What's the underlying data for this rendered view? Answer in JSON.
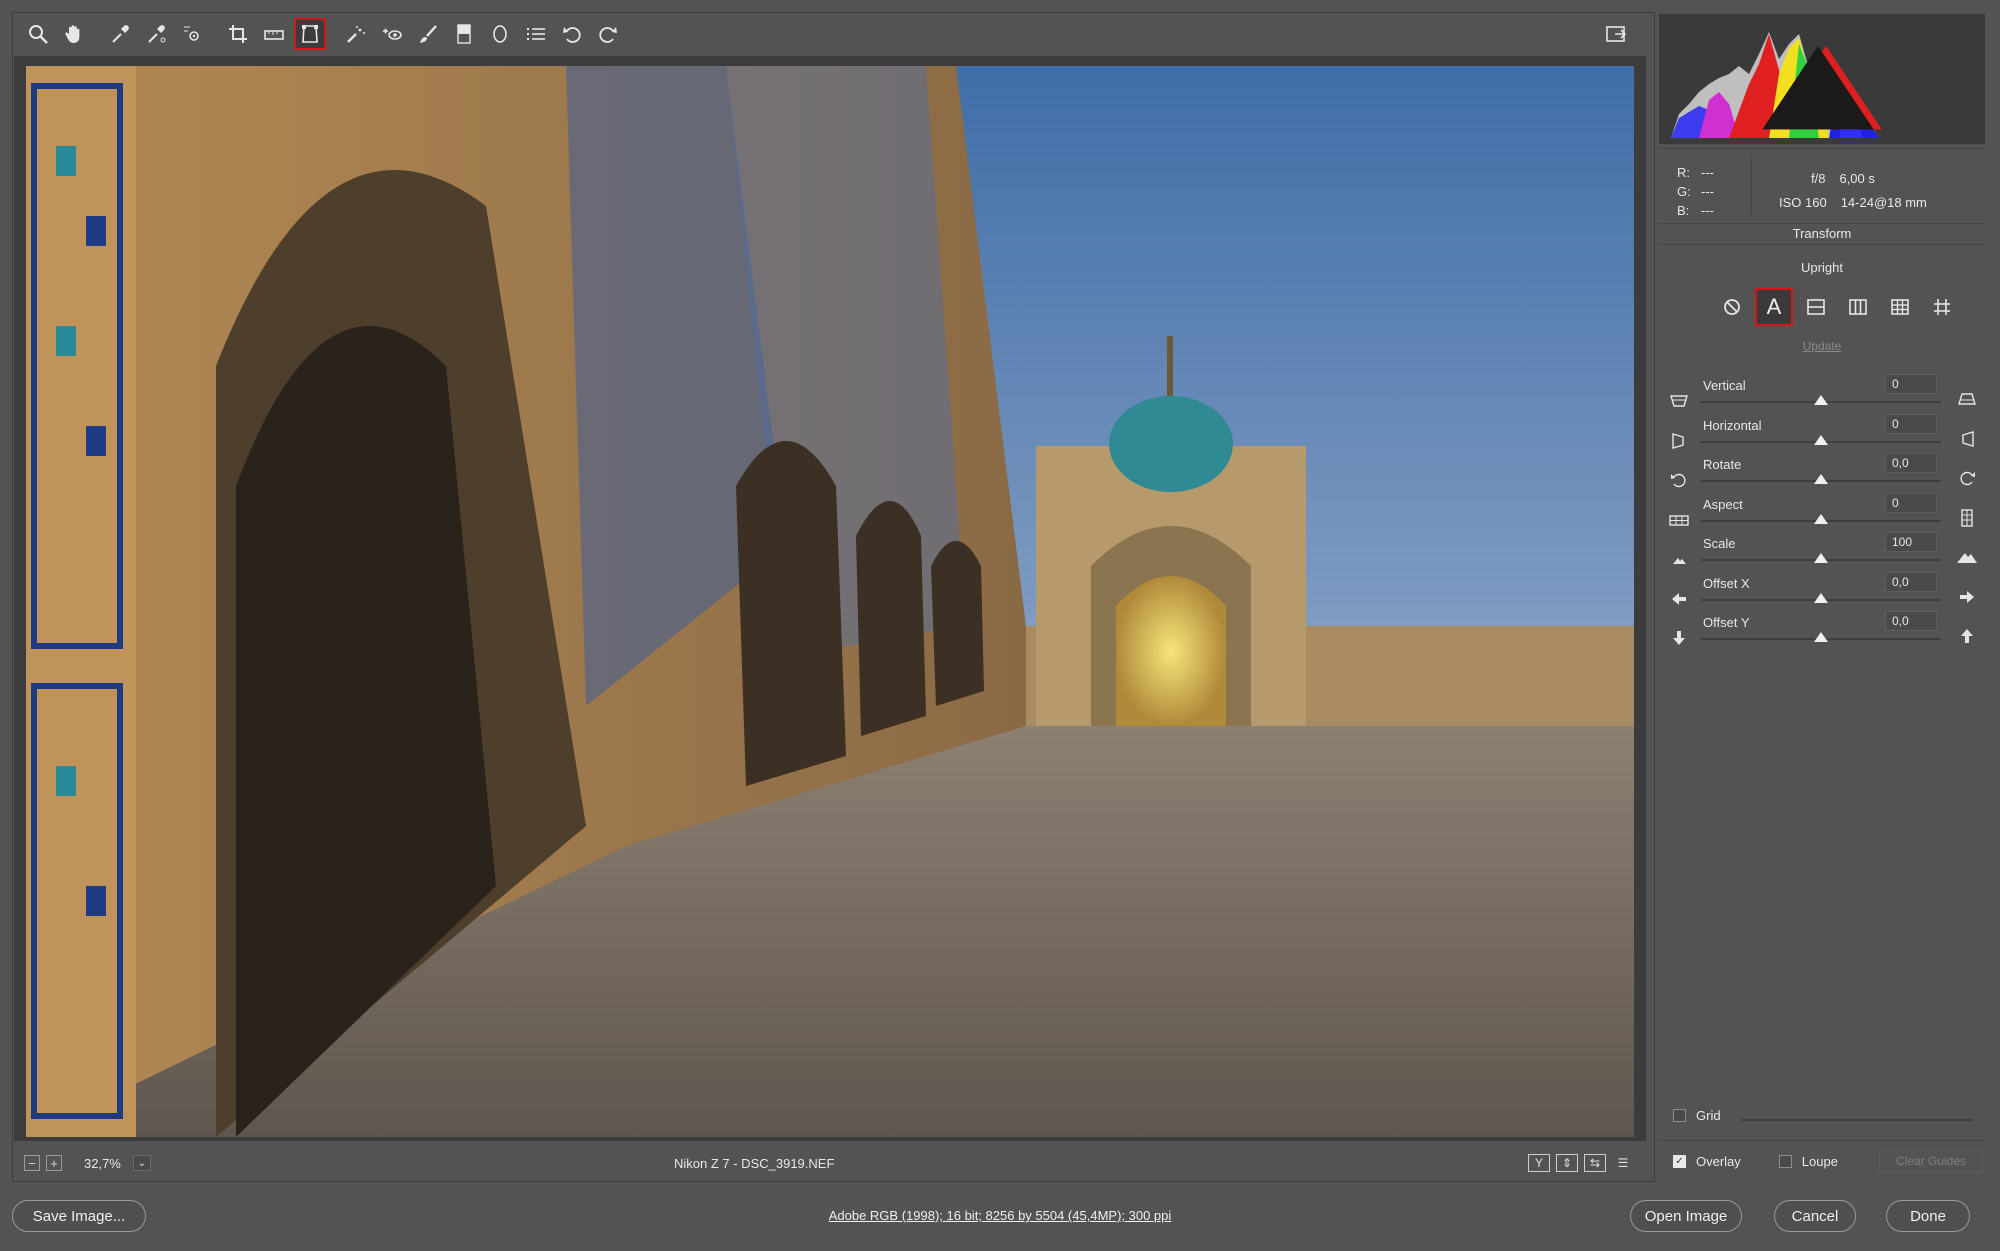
{
  "toolbar": {
    "tools": [
      {
        "name": "zoom-tool-icon"
      },
      {
        "name": "hand-tool-icon"
      },
      {
        "name": "white-balance-tool-icon"
      },
      {
        "name": "color-sampler-tool-icon"
      },
      {
        "name": "targeted-adjustment-tool-icon"
      },
      {
        "name": "crop-tool-icon"
      },
      {
        "name": "straighten-tool-icon"
      },
      {
        "name": "transform-tool-icon",
        "active": true
      },
      {
        "name": "spot-removal-tool-icon"
      },
      {
        "name": "red-eye-removal-tool-icon"
      },
      {
        "name": "adjustment-brush-icon"
      },
      {
        "name": "graduated-filter-icon"
      },
      {
        "name": "radial-filter-icon"
      },
      {
        "name": "preferences-icon"
      },
      {
        "name": "rotate-ccw-icon"
      },
      {
        "name": "rotate-cw-icon"
      }
    ],
    "fullscreen_icon": "toggle-fullscreen-icon"
  },
  "status": {
    "zoom_minus": "−",
    "zoom_plus": "+",
    "zoom_value": "32,7%",
    "zoom_dropdown": "⌄",
    "file_name": "Nikon Z 7  -  DSC_3919.NEF",
    "view_buttons": [
      "Y",
      "⇕",
      "⇆",
      "☰"
    ]
  },
  "panel": {
    "rgb": {
      "r_key": "R:",
      "r_val": "---",
      "g_key": "G:",
      "g_val": "---",
      "b_key": "B:",
      "b_val": "---"
    },
    "exif": {
      "aperture": "f/8",
      "shutter": "6,00 s",
      "iso": "ISO 160",
      "lens": "14-24@18 mm"
    },
    "title": "Transform",
    "upright_label": "Upright",
    "upright_buttons": [
      {
        "name": "upright-off-icon"
      },
      {
        "name": "upright-auto-icon",
        "letter": "A",
        "active": true
      },
      {
        "name": "upright-level-icon"
      },
      {
        "name": "upright-vertical-icon"
      },
      {
        "name": "upright-full-icon"
      },
      {
        "name": "upright-guided-icon"
      }
    ],
    "update_label": "Update",
    "sliders": [
      {
        "label": "Vertical",
        "value": "0"
      },
      {
        "label": "Horizontal",
        "value": "0"
      },
      {
        "label": "Rotate",
        "value": "0,0"
      },
      {
        "label": "Aspect",
        "value": "0"
      },
      {
        "label": "Scale",
        "value": "100"
      },
      {
        "label": "Offset X",
        "value": "0,0"
      },
      {
        "label": "Offset Y",
        "value": "0,0"
      }
    ],
    "grid_label": "Grid",
    "overlay_label": "Overlay",
    "loupe_label": "Loupe",
    "clear_guides_label": "Clear Guides"
  },
  "bottom": {
    "save_label": "Save Image...",
    "workflow_text": "Adobe RGB (1998); 16 bit; 8256 by 5504 (45,4MP); 300 ppi",
    "open_label": "Open Image",
    "cancel_label": "Cancel",
    "done_label": "Done"
  },
  "colors": {
    "accent_highlight": "#d01818",
    "panel_bg": "#535353",
    "dark_bg": "#3c3c3c"
  }
}
